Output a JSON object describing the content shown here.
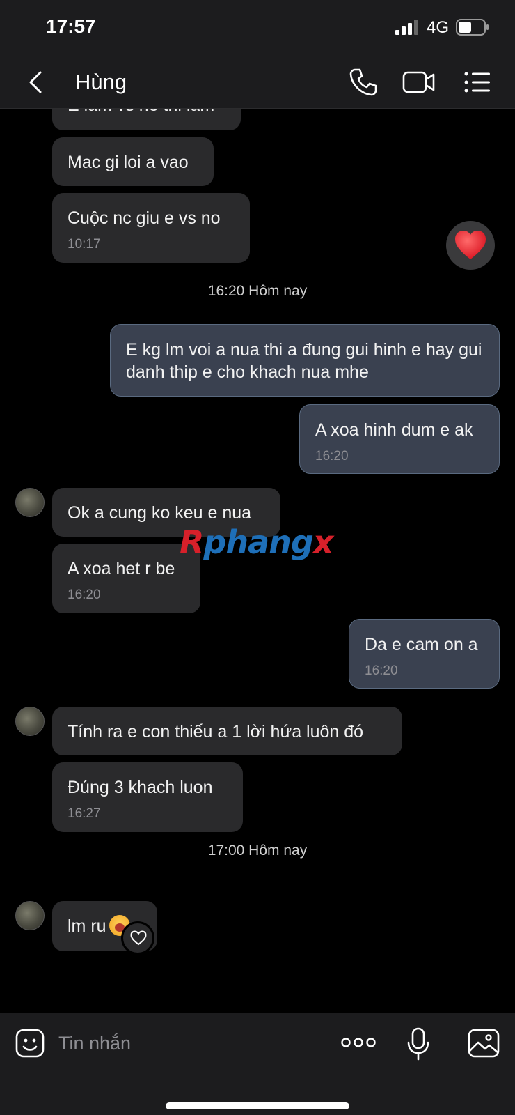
{
  "status_bar": {
    "time": "17:57",
    "network": "4G"
  },
  "header": {
    "contact_name": "Hùng"
  },
  "messages": [
    {
      "text": "E lam vs no thi lam",
      "time": ""
    },
    {
      "text": "Mac gi loi a vao",
      "time": ""
    },
    {
      "text": "Cuộc nc giu e vs no",
      "time": "10:17"
    },
    {
      "text": "E kg lm voi a nua thi a đung gui hinh e hay gui danh thip e cho khach nua mhe",
      "time": ""
    },
    {
      "text": "A xoa hinh dum e ak",
      "time": "16:20"
    },
    {
      "text": "Ok a cung ko keu e nua",
      "time": ""
    },
    {
      "text": "A xoa het r be",
      "time": "16:20"
    },
    {
      "text": "Da e cam on a",
      "time": "16:20"
    },
    {
      "text": "Tính ra e con thiếu a 1 lời hứa luôn đó",
      "time": ""
    },
    {
      "text": "Đúng 3 khach luon",
      "time": "16:27"
    },
    {
      "text": "lm ru",
      "time": ""
    }
  ],
  "day_separators": [
    "16:20 Hôm nay",
    "17:00 Hôm nay"
  ],
  "watermark": {
    "part1": "R",
    "part2": "phang",
    "part3": "x"
  },
  "input": {
    "placeholder": "Tin nhắn"
  },
  "colors": {
    "incoming_bubble": "#2a2a2c",
    "outgoing_bubble": "#3a4150",
    "background": "#000000",
    "bar": "#1c1c1e"
  }
}
